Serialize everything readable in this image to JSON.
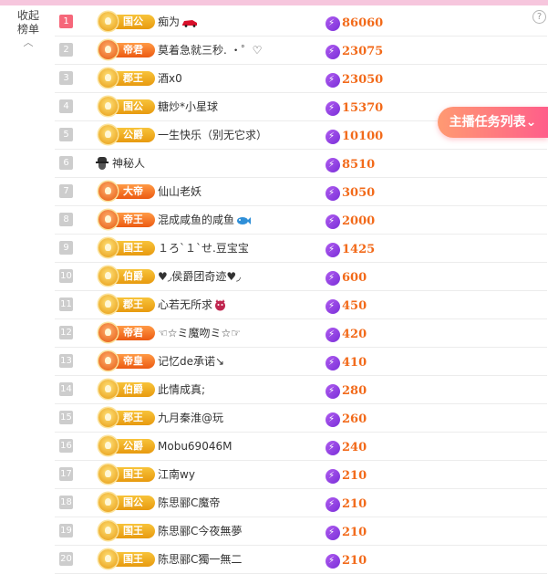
{
  "sidebar": {
    "collapse_label_1": "收起",
    "collapse_label_2": "榜单",
    "collapse_icon": "chevron-up-icon"
  },
  "help": {
    "icon": "question-circle-icon",
    "label": "?"
  },
  "task_button": {
    "label": "主播任务列表",
    "icon": "chevron-down-icon"
  },
  "colors": {
    "rank_top": "#f6677a",
    "rank_default": "#cdcdcd",
    "score": "#f26a1a",
    "bolt": "#8a3fe0",
    "task_grad_start": "#ff9a72",
    "task_grad_end": "#ff5e8a"
  },
  "rows": [
    {
      "rank": "1",
      "title": "国公",
      "name": "痴为",
      "score": "86060",
      "top": true,
      "hot": false,
      "name_icon": "red-car-icon"
    },
    {
      "rank": "2",
      "title": "帝君",
      "name": "莫着急就三秒. ・゜♡",
      "score": "23075",
      "top": false,
      "hot": true,
      "name_icon": ""
    },
    {
      "rank": "3",
      "title": "郡王",
      "name": "酒x0",
      "score": "23050",
      "top": false,
      "hot": false,
      "name_icon": ""
    },
    {
      "rank": "4",
      "title": "国公",
      "name": "糖炒*小星球",
      "score": "15370",
      "top": false,
      "hot": false,
      "name_icon": ""
    },
    {
      "rank": "5",
      "title": "公爵",
      "name": "一生快乐（别无它求）",
      "score": "10100",
      "top": false,
      "hot": false,
      "name_icon": ""
    },
    {
      "rank": "6",
      "title": "",
      "name": "神秘人",
      "score": "8510",
      "top": false,
      "hot": false,
      "name_icon": "mystery-person-icon"
    },
    {
      "rank": "7",
      "title": "大帝",
      "name": "仙山老妖",
      "score": "3050",
      "top": false,
      "hot": true,
      "name_icon": ""
    },
    {
      "rank": "8",
      "title": "帝王",
      "name": "混成咸鱼的咸鱼",
      "score": "2000",
      "top": false,
      "hot": true,
      "name_icon": "fish-icon"
    },
    {
      "rank": "9",
      "title": "国王",
      "name": "１ろ`１`せ.豆宝宝",
      "score": "1425",
      "top": false,
      "hot": false,
      "name_icon": ""
    },
    {
      "rank": "10",
      "title": "伯爵",
      "name": "♥◞侯爵团奇迹♥◞",
      "score": "600",
      "top": false,
      "hot": false,
      "name_icon": ""
    },
    {
      "rank": "11",
      "title": "郡王",
      "name": "心若无所求",
      "score": "450",
      "top": false,
      "hot": false,
      "name_icon": "devil-icon"
    },
    {
      "rank": "12",
      "title": "帝君",
      "name": "☜☆ミ魔吻ミ☆☞",
      "score": "420",
      "top": false,
      "hot": true,
      "name_icon": ""
    },
    {
      "rank": "13",
      "title": "帝皇",
      "name": "记忆de承诺↘",
      "score": "410",
      "top": false,
      "hot": true,
      "name_icon": ""
    },
    {
      "rank": "14",
      "title": "伯爵",
      "name": "此情成真;",
      "score": "280",
      "top": false,
      "hot": false,
      "name_icon": ""
    },
    {
      "rank": "15",
      "title": "郡王",
      "name": "九月秦淮@玩",
      "score": "260",
      "top": false,
      "hot": false,
      "name_icon": ""
    },
    {
      "rank": "16",
      "title": "公爵",
      "name": "Mobu69046M",
      "score": "240",
      "top": false,
      "hot": false,
      "name_icon": ""
    },
    {
      "rank": "17",
      "title": "国王",
      "name": "江南wy",
      "score": "210",
      "top": false,
      "hot": false,
      "name_icon": ""
    },
    {
      "rank": "18",
      "title": "国公",
      "name": "陈思郦C魔帝",
      "score": "210",
      "top": false,
      "hot": false,
      "name_icon": ""
    },
    {
      "rank": "19",
      "title": "国王",
      "name": "陈思郦C今夜無夢",
      "score": "210",
      "top": false,
      "hot": false,
      "name_icon": ""
    },
    {
      "rank": "20",
      "title": "国王",
      "name": "陈思郦C獨一無二",
      "score": "210",
      "top": false,
      "hot": false,
      "name_icon": ""
    }
  ]
}
